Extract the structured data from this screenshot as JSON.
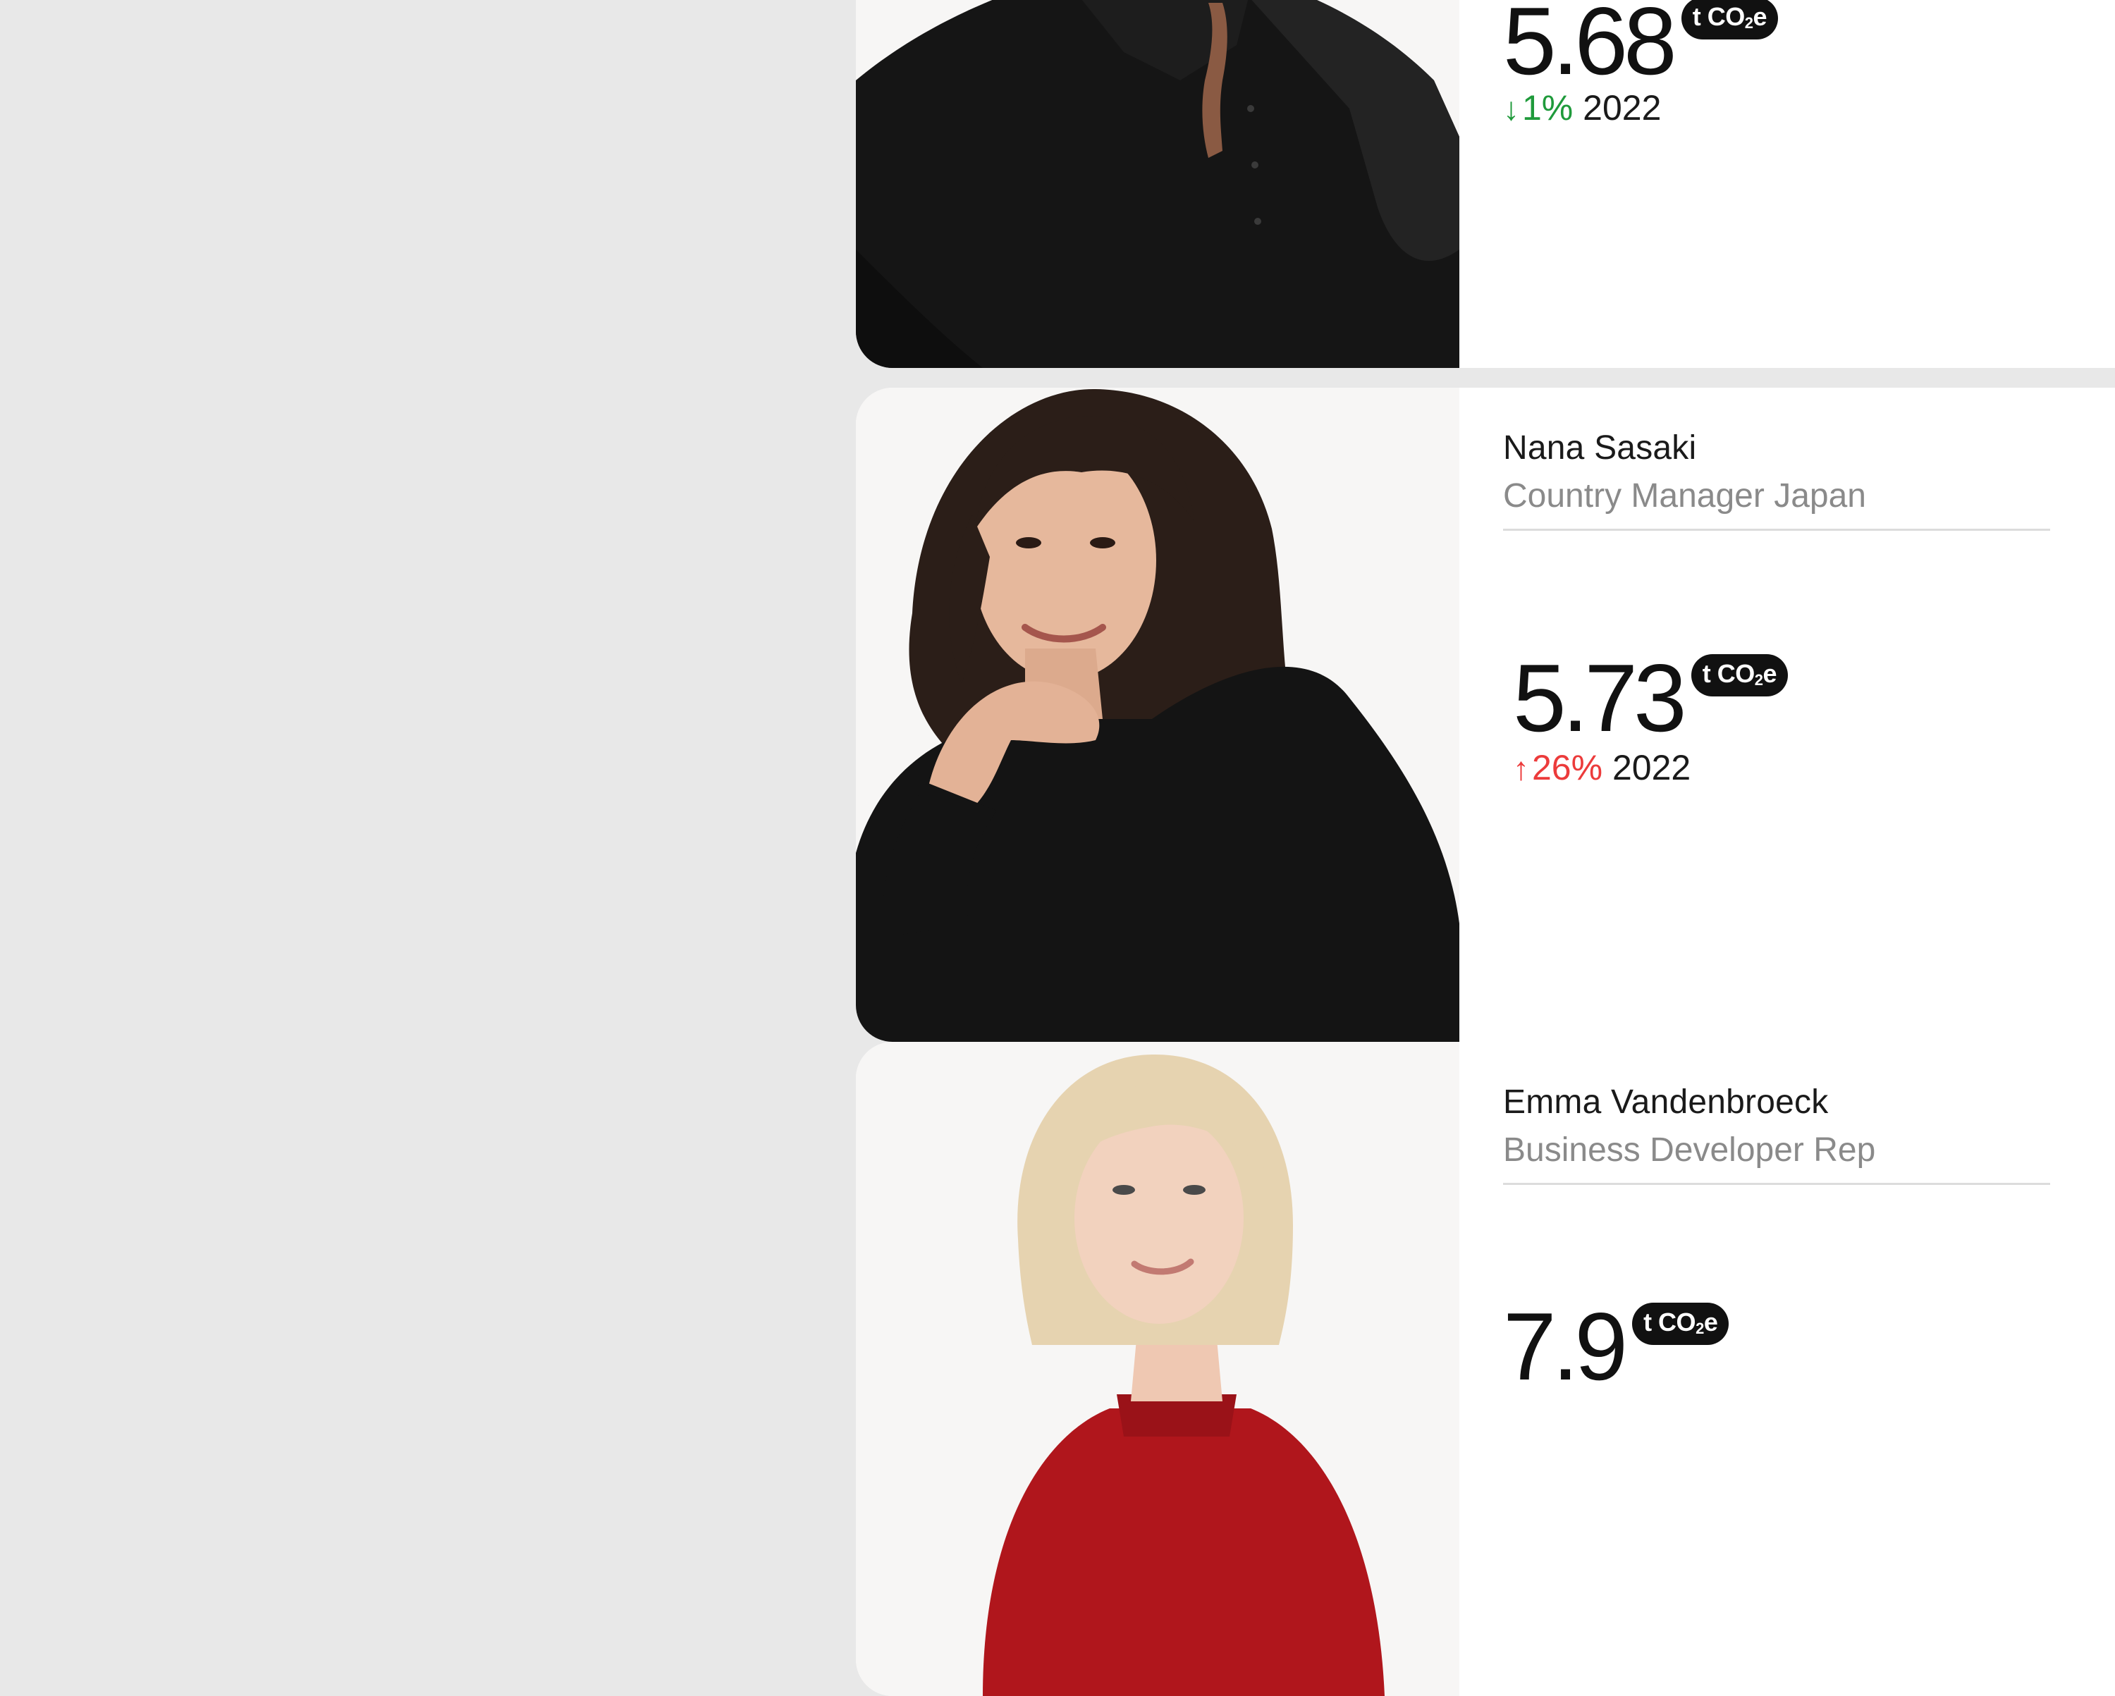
{
  "unit": {
    "prefix": "t CO",
    "sub": "2",
    "suffix": "e"
  },
  "cards": [
    {
      "name": "",
      "role": "",
      "value": "5.68",
      "change": {
        "direction": "down",
        "arrow": "↓",
        "percent": "1%",
        "year": "2022",
        "color": "#1f9a3b"
      },
      "photo": {
        "background": "#f7f6f5",
        "clothing": "#151515"
      }
    },
    {
      "name": "Nana Sasaki",
      "role": "Country Manager Japan",
      "value": "5.73",
      "change": {
        "direction": "up",
        "arrow": "↑",
        "percent": "26%",
        "year": "2022",
        "color": "#ec3b3b"
      },
      "photo": {
        "background": "#f7f6f5",
        "clothing": "#141414"
      }
    },
    {
      "name": "Emma Vandenbroeck",
      "role": "Business Developer Rep",
      "value": "7.9",
      "photo": {
        "background": "#f7f6f5",
        "clothing": "#b0161c"
      }
    }
  ]
}
